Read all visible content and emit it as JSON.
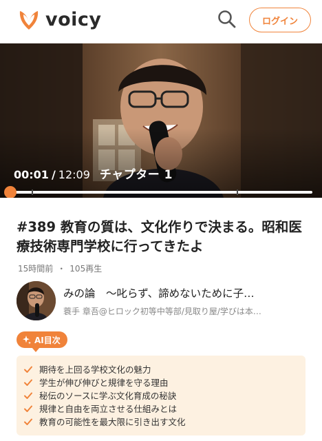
{
  "header": {
    "brand_name": "voicy",
    "login_label": "ログイン",
    "accent_color": "#f0833a"
  },
  "player": {
    "current_time": "00:01",
    "separator": "/",
    "duration": "12:09",
    "chapter_label": "チャプター 1",
    "progress_fraction": 0.0014
  },
  "episode": {
    "title": "#389 教育の質は、文化作りで決まる。昭和医療技術専門学校に行ってきたよ",
    "posted": "15時間前",
    "meta_separator": "・",
    "plays": "105再生"
  },
  "channel": {
    "name": "みの論　〜叱らず、諦めないために子…",
    "host": "蓑手 章吾@ヒロック初等中等部/見取り屋/学びは本…"
  },
  "ai_summary": {
    "badge_label": "AI目次",
    "items": [
      "期待を上回る学校文化の魅力",
      "学生が伸び伸びと規律を守る理由",
      "秘伝のソースに学ぶ文化育成の秘訣",
      "規律と自由を両立させる仕組みとは",
      "教育の可能性を最大限に引き出す文化"
    ]
  }
}
